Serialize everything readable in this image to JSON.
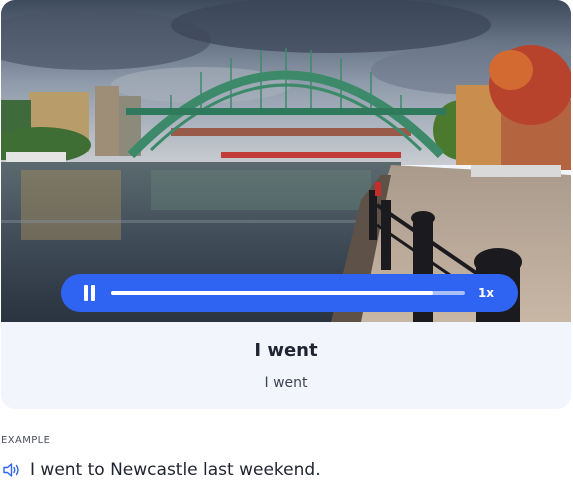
{
  "player": {
    "progress": 0.91,
    "speed_label": "1x",
    "accent_color": "#2f64f2",
    "pause_icon": "pause-icon"
  },
  "card": {
    "word": "I went",
    "translation": "I went",
    "image": "tyne-bridge-newcastle-photo"
  },
  "example": {
    "label": "EXAMPLE",
    "sentence": "I went to Newcastle last weekend.",
    "icon": "speaker-icon"
  }
}
